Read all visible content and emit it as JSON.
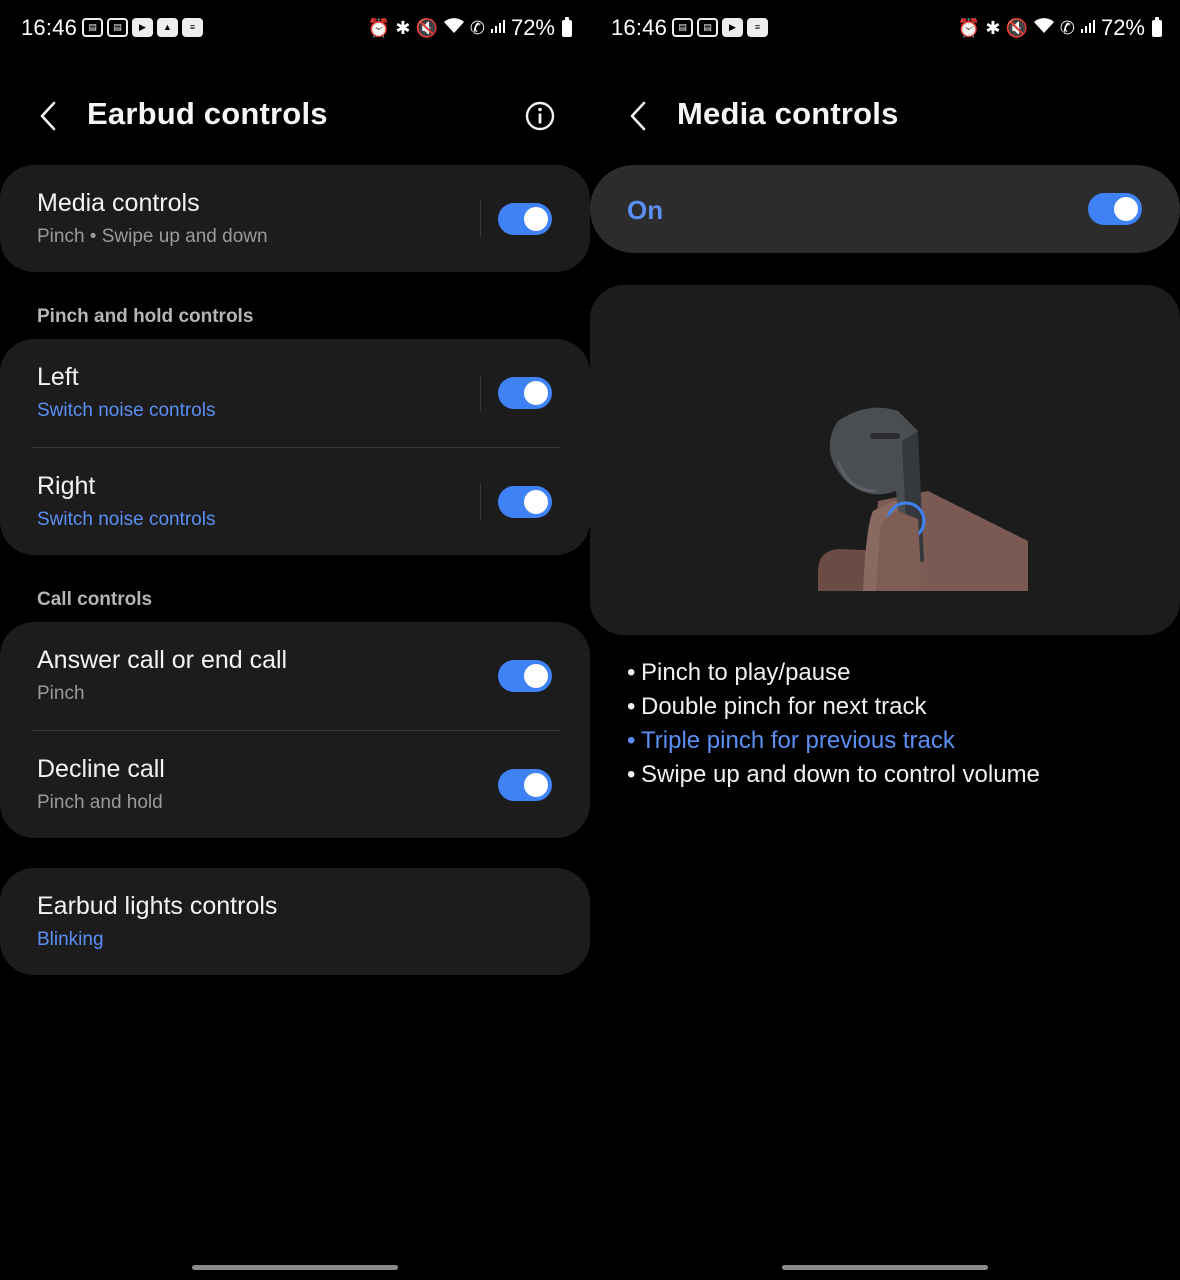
{
  "status_bar": {
    "time": "16:46",
    "notification_icons": [
      "app-icon",
      "app-icon",
      "youtube-icon",
      "gallery-icon",
      "news-icon"
    ],
    "system_icons": [
      "alarm-icon",
      "bluetooth-icon",
      "mute-icon",
      "wifi-icon",
      "wifi-calling-icon",
      "signal-icon"
    ],
    "battery_text": "72%"
  },
  "earbud_controls": {
    "title": "Earbud controls",
    "media": {
      "label": "Media controls",
      "sub": "Pinch • Swipe up and down",
      "on": true
    },
    "pinch_hold": {
      "section": "Pinch and hold controls",
      "left": {
        "label": "Left",
        "sub": "Switch noise controls",
        "on": true
      },
      "right": {
        "label": "Right",
        "sub": "Switch noise controls",
        "on": true
      }
    },
    "call": {
      "section": "Call controls",
      "answer": {
        "label": "Answer call or end call",
        "sub": "Pinch",
        "on": true
      },
      "decline": {
        "label": "Decline call",
        "sub": "Pinch and hold",
        "on": true
      }
    },
    "lights": {
      "label": "Earbud lights controls",
      "sub": "Blinking"
    }
  },
  "media_controls": {
    "title": "Media controls",
    "on_label": "On",
    "on": true,
    "bullets": [
      {
        "dot": "•",
        "text": "Pinch to play/pause"
      },
      {
        "dot": "•",
        "text": "Double pinch for next track"
      },
      {
        "dot": "•",
        "text": "Triple pinch for previous track"
      },
      {
        "dot": "•",
        "text": "Swipe up and down to control volume"
      }
    ]
  },
  "colors": {
    "accent": "#3f82f5",
    "accent_text": "#5b8ff4",
    "card": "#1c1c1c",
    "background": "#000000"
  }
}
